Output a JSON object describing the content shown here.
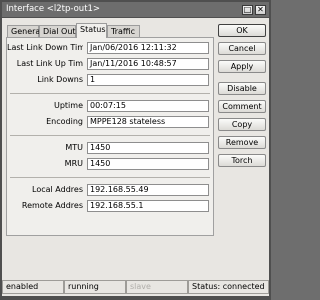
{
  "window": {
    "title": "Interface <l2tp-out1>",
    "minimize_label": "□",
    "close_label": "✕"
  },
  "tabs": [
    {
      "label": "General"
    },
    {
      "label": "Dial Out"
    },
    {
      "label": "Status"
    },
    {
      "label": "Traffic"
    }
  ],
  "status": {
    "fields": {
      "last_link_down_time": {
        "label": "Last Link Down Tim",
        "value": "Jan/06/2016 12:11:32"
      },
      "last_link_up_time": {
        "label": "Last Link Up Tim",
        "value": "Jan/11/2016 10:48:57"
      },
      "link_downs": {
        "label": "Link Downs",
        "value": "1"
      },
      "uptime": {
        "label": "Uptime",
        "value": "00:07:15"
      },
      "encoding": {
        "label": "Encoding",
        "value": "MPPE128 stateless"
      },
      "mtu": {
        "label": "MTU",
        "value": "1450"
      },
      "mru": {
        "label": "MRU",
        "value": "1450"
      },
      "local_address": {
        "label": "Local Addres",
        "value": "192.168.55.49"
      },
      "remote_address": {
        "label": "Remote Addres",
        "value": "192.168.55.1"
      }
    }
  },
  "buttons": {
    "ok": "OK",
    "cancel": "Cancel",
    "apply": "Apply",
    "disable": "Disable",
    "comment": "Comment",
    "copy": "Copy",
    "remove": "Remove",
    "torch": "Torch"
  },
  "statusbar": {
    "state": "enabled",
    "running": "running",
    "slave": "slave",
    "status": "Status: connected"
  }
}
